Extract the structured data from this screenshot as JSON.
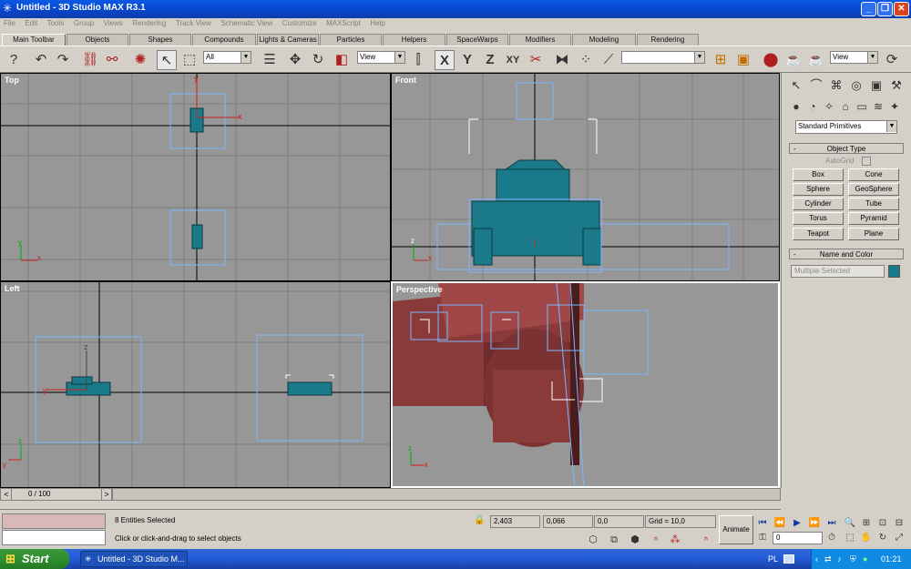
{
  "window": {
    "title": "Untitled - 3D Studio MAX R3.1",
    "app_icon": "max-star-icon"
  },
  "menu": [
    "File",
    "Edit",
    "Tools",
    "Group",
    "Views",
    "Rendering",
    "Track View",
    "Schematic View",
    "Customize",
    "MAXScript",
    "Help"
  ],
  "tabs": [
    "Main Toolbar",
    "Objects",
    "Shapes",
    "Compounds",
    "Lights & Cameras",
    "Particles",
    "Helpers",
    "SpaceWarps",
    "Modifiers",
    "Modeling",
    "Rendering"
  ],
  "toolbar": {
    "selection_filter": "All",
    "ref_coord": "View",
    "axis_labels": {
      "x": "X",
      "y": "Y",
      "z": "Z",
      "xy": "XY"
    },
    "named_selection": "",
    "render_view": "View"
  },
  "viewports": {
    "top": "Top",
    "front": "Front",
    "left": "Left",
    "perspective": "Perspective",
    "axis": {
      "x": "x",
      "y": "y",
      "z": "z"
    }
  },
  "command_panel": {
    "category": "Standard Primitives",
    "object_type_title": "Object Type",
    "autogrid": "AutoGrid",
    "buttons": [
      "Box",
      "Cone",
      "Sphere",
      "GeoSphere",
      "Cylinder",
      "Tube",
      "Torus",
      "Pyramid",
      "Teapot",
      "Plane"
    ],
    "name_color_title": "Name and Color",
    "name_field": "Multiple Selected",
    "color": "#1a7a8a",
    "minus": "-"
  },
  "timeline": {
    "position": "0 / 100",
    "prev": "<",
    "next": ">"
  },
  "status": {
    "selection": "8 Entities Selected",
    "prompt": "Click or click-and-drag to select objects",
    "x": "2,403",
    "y": "0,066",
    "z": "0,0",
    "grid": "Grid = 10,0",
    "animate": "Animate",
    "frame": "0"
  },
  "taskbar": {
    "start": "Start",
    "item": "Untitled - 3D Studio M...",
    "lang": "PL",
    "clock": "01:21"
  },
  "colors": {
    "title": "#0a5ae6",
    "viewport": "#979797",
    "mesh": "#1a7a8a",
    "tank_red": "#8b3a3a",
    "gizmo": "#7fb6ff"
  }
}
